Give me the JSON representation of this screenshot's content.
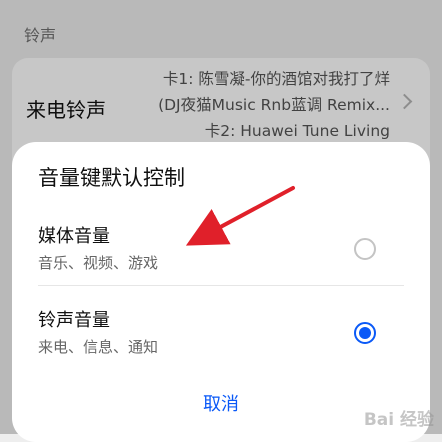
{
  "header": {
    "section_title": "铃声"
  },
  "ringtone": {
    "label": "来电铃声",
    "values": [
      "卡1: 陈雪凝-你的酒馆对我打了烊",
      "(DJ夜猫Music Rnb蓝调 Remix...",
      "卡2: Huawei Tune Living"
    ]
  },
  "dialog": {
    "title": "音量键默认控制",
    "options": [
      {
        "title": "媒体音量",
        "subtitle": "音乐、视频、游戏",
        "selected": false
      },
      {
        "title": "铃声音量",
        "subtitle": "来电、信息、通知",
        "selected": true
      }
    ],
    "cancel_label": "取消"
  },
  "watermark": "Bai 经验",
  "colors": {
    "accent": "#0a59f7",
    "annotation_arrow": "#e0202a"
  }
}
